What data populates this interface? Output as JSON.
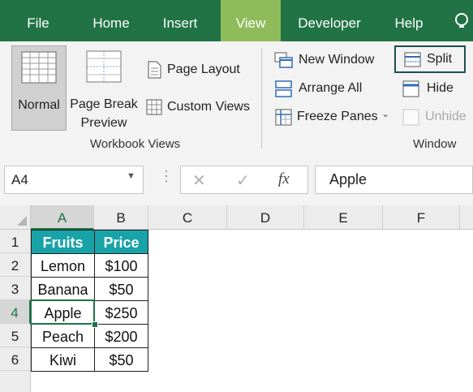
{
  "tabs": [
    "File",
    "Home",
    "Insert",
    "View",
    "Developer",
    "Help"
  ],
  "active_tab": "View",
  "ribbon": {
    "normal": "Normal",
    "page_break_line1": "Page Break",
    "page_break_line2": "Preview",
    "page_layout": "Page Layout",
    "custom_views": "Custom Views",
    "workbook_views": "Workbook Views",
    "new_window": "New Window",
    "arrange_all": "Arrange All",
    "freeze_panes": "Freeze Panes",
    "split": "Split",
    "hide": "Hide",
    "unhide": "Unhide",
    "window_group": "Window"
  },
  "formula_bar": {
    "name_box": "A4",
    "fx": "fx",
    "content": "Apple"
  },
  "grid": {
    "columns": [
      "A",
      "B",
      "C",
      "D",
      "E",
      "F"
    ],
    "rows": [
      "1",
      "2",
      "3",
      "4",
      "5",
      "6",
      ""
    ],
    "headers": [
      "Fruits",
      "Price"
    ],
    "data": [
      [
        "Lemon",
        "$100"
      ],
      [
        "Banana",
        "$50"
      ],
      [
        "Apple",
        "$250"
      ],
      [
        "Peach",
        "$200"
      ],
      [
        "Kiwi",
        "$50"
      ]
    ]
  },
  "colors": {
    "tab_bar": "#217346",
    "active_tab": "#8fbc5a",
    "table_header": "#17a3a8",
    "selection": "#217346"
  }
}
